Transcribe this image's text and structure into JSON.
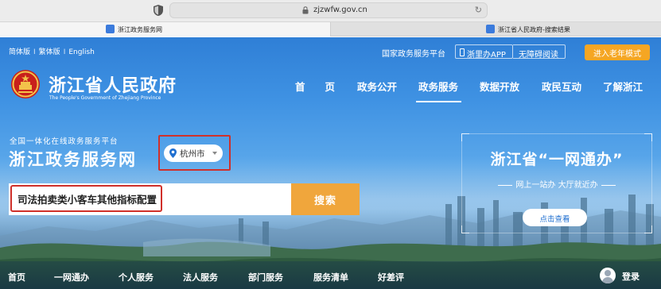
{
  "browser": {
    "url": "zjzwfw.gov.cn",
    "tabs": [
      {
        "label": "浙江政务服务网"
      },
      {
        "label": "浙江省人民政府-搜索结果"
      }
    ]
  },
  "header": {
    "versions": [
      "简体版",
      "繁体版",
      "English"
    ],
    "separator": "I",
    "national_platform": "国家政务服务平台",
    "app_label": "浙里办APP",
    "accessibility_label": "无障碍阅读",
    "elder_mode_label": "进入老年模式",
    "logo_title": "浙江省人民政府",
    "logo_subtitle": "The People's Government of Zhejiang Province"
  },
  "main_nav": {
    "items": [
      "首　　页",
      "政务公开",
      "政务服务",
      "数据开放",
      "政民互动",
      "了解浙江"
    ],
    "active": "政务服务"
  },
  "platform": {
    "small_title": "全国一体化在线政务服务平台",
    "big_title": "浙江政务服务网",
    "city": "杭州市"
  },
  "search": {
    "value": "司法拍卖类小客车其他指标配置",
    "button_label": "搜索"
  },
  "promo": {
    "title": "浙江省“一网通办”",
    "subtitle": "网上一站办 大厅就近办",
    "button_label": "点击查看"
  },
  "bottom_nav": {
    "items": [
      "首页",
      "一网通办",
      "个人服务",
      "法人服务",
      "部门服务",
      "服务清单",
      "好差评"
    ],
    "login_label": "登录"
  },
  "colors": {
    "accent_orange": "#f0a63c",
    "highlight_red": "#d0302a",
    "link_blue": "#1f6fd0"
  }
}
